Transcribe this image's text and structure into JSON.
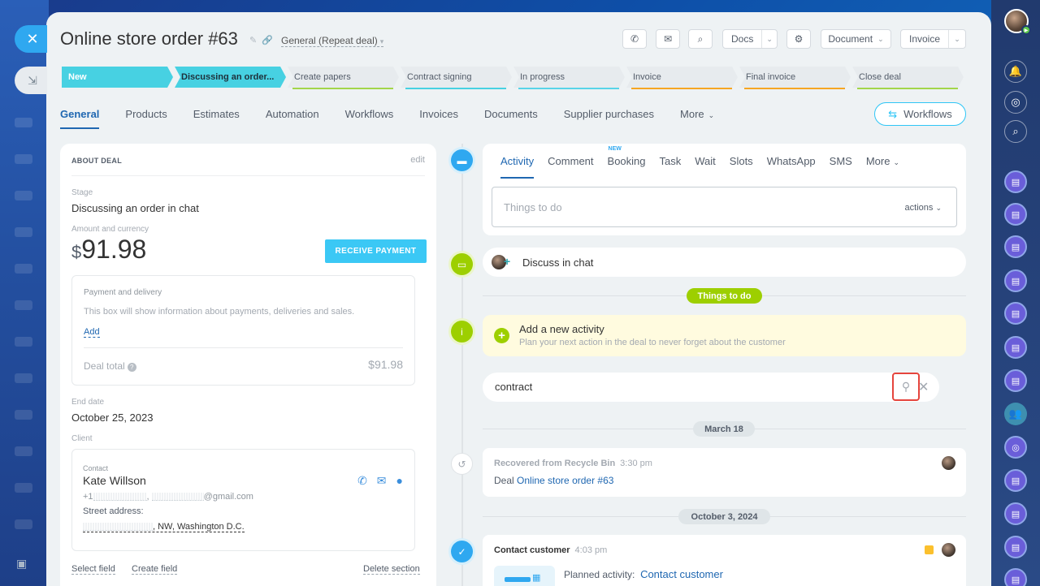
{
  "window": {
    "title": "Online store order #63",
    "category": "General (Repeat deal)"
  },
  "header": {
    "docs_label": "Docs",
    "document_label": "Document",
    "invoice_label": "Invoice"
  },
  "stages": [
    {
      "label": "New",
      "state": "done",
      "accent": "#47d1e2"
    },
    {
      "label": "Discussing an order...",
      "state": "current",
      "accent": "#47d1e2"
    },
    {
      "label": "Create papers",
      "state": "todo",
      "accent": "#a3d64a"
    },
    {
      "label": "Contract signing",
      "state": "todo",
      "accent": "#47d1e2"
    },
    {
      "label": "In progress",
      "state": "todo",
      "accent": "#58d4e8"
    },
    {
      "label": "Invoice",
      "state": "todo",
      "accent": "#f6a623"
    },
    {
      "label": "Final invoice",
      "state": "todo",
      "accent": "#f6a623"
    },
    {
      "label": "Close deal",
      "state": "todo",
      "accent": "#a3d64a"
    }
  ],
  "tabs": [
    "General",
    "Products",
    "Estimates",
    "Automation",
    "Workflows",
    "Invoices",
    "Documents",
    "Supplier purchases",
    "More"
  ],
  "workflows_button": "Workflows",
  "about": {
    "heading": "ABOUT DEAL",
    "edit": "edit",
    "stage_label": "Stage",
    "stage_value": "Discussing an order in chat",
    "amount_label": "Amount and currency",
    "currency": "$",
    "amount": "91.98",
    "receive_payment": "RECEIVE PAYMENT",
    "payment": {
      "title": "Payment and delivery",
      "description": "This box will show information about payments, deliveries and sales.",
      "add": "Add",
      "total_label": "Deal total",
      "total_value": "$91.98"
    },
    "end_date_label": "End date",
    "end_date": "October 25, 2023",
    "client_label": "Client",
    "contact": {
      "label": "Contact",
      "name": "Kate Willson",
      "phone_prefix": "+1",
      "email_suffix": "@gmail.com",
      "street_label": "Street address:",
      "address_suffix": ", NW, Washington D.C."
    },
    "select_field": "Select field",
    "create_field": "Create field",
    "delete_section": "Delete section"
  },
  "editor": {
    "tabs": [
      "Activity",
      "Comment",
      "Booking",
      "Task",
      "Wait",
      "Slots",
      "WhatsApp",
      "SMS",
      "More"
    ],
    "new_badge": "NEW",
    "placeholder": "Things to do",
    "actions": "actions"
  },
  "timeline": {
    "chat_item": "Discuss in chat",
    "things_to_do": "Things to do",
    "add_activity_title": "Add a new activity",
    "add_activity_desc": "Plan your next action in the deal to never forget about the customer",
    "search_value": "contract",
    "date1": "March 18",
    "recovered_title": "Recovered from Recycle Bin",
    "recovered_time": "3:30 pm",
    "recovered_prefix": "Deal",
    "recovered_link": "Online store order #63",
    "date2": "October 3, 2024",
    "contact_title": "Contact customer",
    "contact_time": "4:03 pm",
    "planned_label": "Planned activity:",
    "planned_link": "Contact customer"
  }
}
